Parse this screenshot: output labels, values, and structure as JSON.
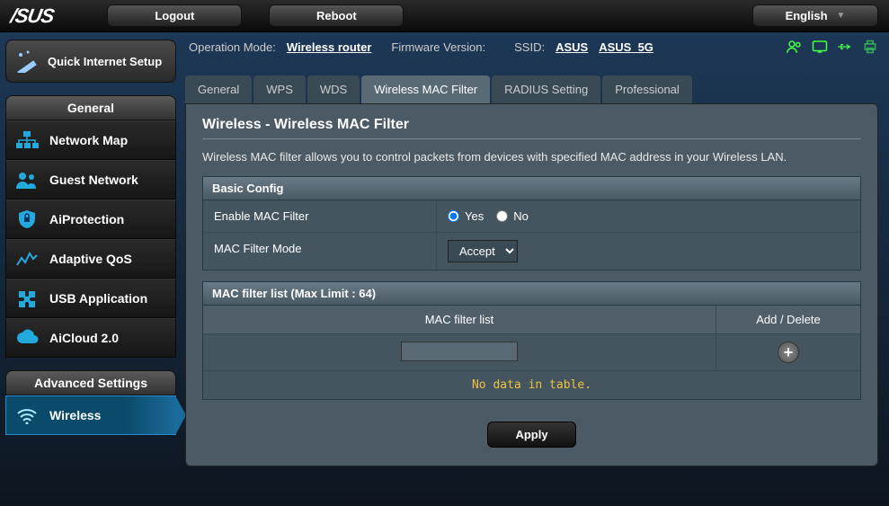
{
  "brand": "/SUS",
  "top": {
    "logout": "Logout",
    "reboot": "Reboot",
    "language": "English"
  },
  "info": {
    "op_mode_label": "Operation Mode:",
    "op_mode_value": "Wireless router",
    "fw_label": "Firmware Version:",
    "ssid_label": "SSID:",
    "ssid1": "ASUS",
    "ssid2": "ASUS_5G"
  },
  "sidebar": {
    "qis": "Quick Internet Setup",
    "general_header": "General",
    "items": [
      {
        "label": "Network Map",
        "icon": "network-map"
      },
      {
        "label": "Guest Network",
        "icon": "guest"
      },
      {
        "label": "AiProtection",
        "icon": "shield"
      },
      {
        "label": "Adaptive QoS",
        "icon": "qos"
      },
      {
        "label": "USB Application",
        "icon": "usb"
      },
      {
        "label": "AiCloud 2.0",
        "icon": "cloud"
      }
    ],
    "advanced_header": "Advanced Settings",
    "adv_items": [
      {
        "label": "Wireless",
        "icon": "wifi",
        "active": true
      }
    ]
  },
  "tabs": [
    "General",
    "WPS",
    "WDS",
    "Wireless MAC Filter",
    "RADIUS Setting",
    "Professional"
  ],
  "active_tab": 3,
  "panel": {
    "title": "Wireless - Wireless MAC Filter",
    "desc": "Wireless MAC filter allows you to control packets from devices with specified MAC address in your Wireless LAN.",
    "basic_header": "Basic Config",
    "enable_label": "Enable MAC Filter",
    "yes": "Yes",
    "no": "No",
    "enable_value": "Yes",
    "mode_label": "MAC Filter Mode",
    "mode_value": "Accept",
    "list_header": "MAC filter list (Max Limit : 64)",
    "col_mac": "MAC filter list",
    "col_action": "Add / Delete",
    "nodata": "No data in table.",
    "apply": "Apply"
  }
}
